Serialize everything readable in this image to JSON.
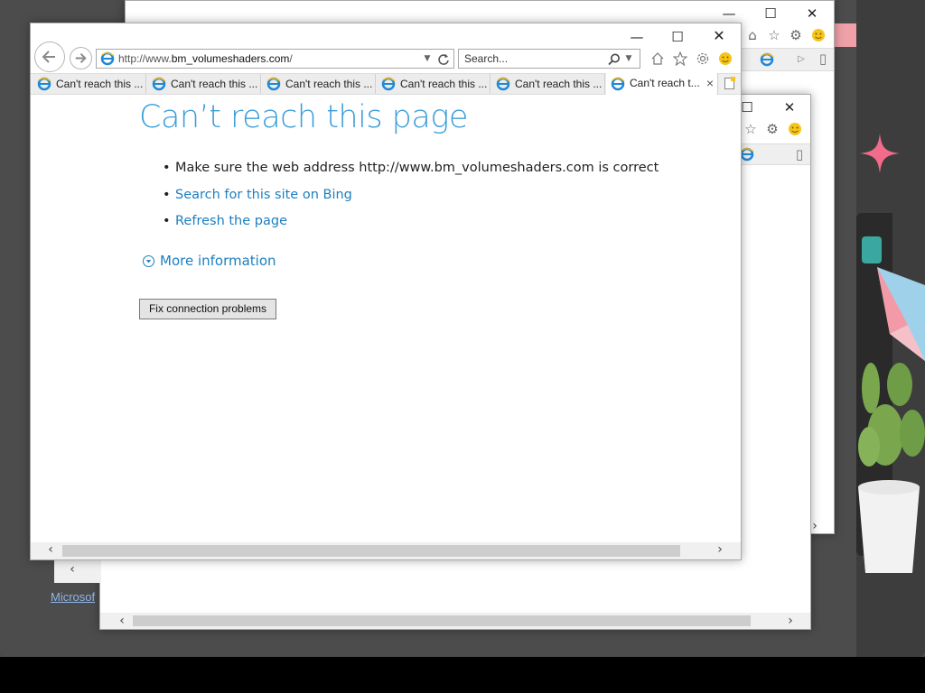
{
  "main_window": {
    "address_url_prefix": "http://www.",
    "address_url_domain": "bm_volumeshaders.com",
    "address_url_suffix": "/",
    "search_placeholder": "Search...",
    "tabs": [
      {
        "label": "Can't reach this ..."
      },
      {
        "label": "Can't reach this ..."
      },
      {
        "label": "Can't reach this ..."
      },
      {
        "label": "Can't reach this ..."
      },
      {
        "label": "Can't reach this ..."
      },
      {
        "label": "Can't reach t..."
      }
    ],
    "tab_close": "×",
    "content": {
      "title": "Can’t reach this page",
      "bullet_1": "Make sure the web address http://www.bm_volumeshaders.com is correct",
      "bullet_2": "Search for this site on Bing",
      "bullet_3": "Refresh the page",
      "more_information": "More information",
      "fix_button": "Fix connection problems"
    }
  },
  "background_link": "Microsof",
  "colors": {
    "title_blue": "#3c9ed8",
    "link_blue": "#1c7fc0",
    "desktop": "#4c4c4c"
  },
  "icons": [
    "back-arrow-icon",
    "forward-arrow-icon",
    "ie-logo-icon",
    "refresh-icon",
    "search-icon",
    "home-icon",
    "favorites-star-icon",
    "settings-gear-icon",
    "smiley-feedback-icon",
    "new-tab-icon",
    "minimize-icon",
    "maximize-icon",
    "close-icon"
  ]
}
